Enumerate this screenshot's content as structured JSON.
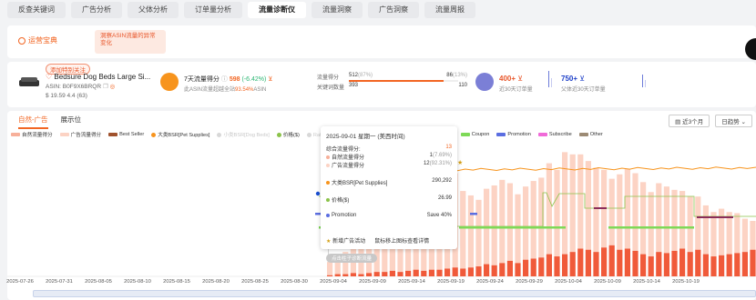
{
  "top_tabs": [
    "反查关键词",
    "广告分析",
    "父体分析",
    "订单量分析",
    "流量诊断仪",
    "流量洞察",
    "广告洞察",
    "流量周报"
  ],
  "top_tabs_active": 4,
  "subnav": {
    "item1": "运营宝典",
    "item2": "洞察ASIN流量的异常变化"
  },
  "product": {
    "tag": "添加特别关注",
    "title": "Bedsure Dog Beds Large Si...",
    "asin": "ASIN: B0F9X6BRQR",
    "price": "$ 19.59",
    "rating": "4.4 (63)"
  },
  "flow_score": {
    "label": "7天流量得分",
    "value": "598",
    "change": "(-6.42%)",
    "sub_prefix": "此ASIN流量超越全站",
    "sub_pct": "93.54%",
    "sub_suffix": "ASIN"
  },
  "keywords": {
    "row1_label": "流量得分",
    "row1_value": "512",
    "row1_pct": "(87%)",
    "row1_right": "86",
    "row1_right_pct": "(13%)",
    "row2_label": "关键词数量",
    "row2_value": "393",
    "row2_right": "110"
  },
  "orders": {
    "value": "400+",
    "label": "近30天订单量"
  },
  "parent_orders": {
    "value": "750+",
    "label": "父体近30天订单量"
  },
  "chart_tabs": [
    "自然-广告",
    "展示位"
  ],
  "chart_controls": [
    "近3个月",
    "日趋势"
  ],
  "legend": [
    {
      "label": "自然流量得分",
      "color": "#f7b09a",
      "kind": "sw",
      "faded": false
    },
    {
      "label": "广告流量得分",
      "color": "#fcd3c4",
      "kind": "sw",
      "faded": false
    },
    {
      "label": "Best Seller",
      "color": "#a0522d",
      "kind": "sw",
      "faded": false
    },
    {
      "label": "大类BSR[Pet Supplies]",
      "color": "#f7941d",
      "kind": "dt",
      "faded": false
    },
    {
      "label": "小类BSR[Dog Beds]",
      "color": "#d8d8d8",
      "kind": "dt",
      "faded": true
    },
    {
      "label": "价格($)",
      "color": "#8bc34a",
      "kind": "dt",
      "faded": false
    },
    {
      "label": "Ratings数量",
      "color": "#d8d8d8",
      "kind": "dt",
      "faded": true
    },
    {
      "label": "修改标题",
      "color": "#1a4fd0",
      "kind": "dt",
      "faded": false
    },
    {
      "label": "修改主图",
      "color": "#f5a623",
      "kind": "dt",
      "faded": false
    },
    {
      "label": "新增广告活动",
      "color": "#d4a017",
      "kind": "star",
      "faded": false
    },
    {
      "label": "Coupon",
      "color": "#7ed957",
      "kind": "sw",
      "faded": false
    },
    {
      "label": "Promotion",
      "color": "#5b6ee1",
      "kind": "sw",
      "faded": false
    },
    {
      "label": "Subscribe",
      "color": "#f06ad8",
      "kind": "sw",
      "faded": false
    },
    {
      "label": "Other",
      "color": "#9c8a74",
      "kind": "sw",
      "faded": false
    }
  ],
  "tooltip": {
    "title": "2025-09-01 星期一 (美西时间)",
    "score_label": "综合流量得分:",
    "score_value": "13",
    "natural_label": "自然流量得分",
    "natural_value": "1",
    "natural_pct": "(7.69%)",
    "ad_label": "广告流量得分",
    "ad_value": "12",
    "ad_pct": "(92.31%)",
    "bsr_label": "大类BSR[Pet Supplies]",
    "bsr_value": "290,292",
    "price_label": "价格($)",
    "price_value": "26.99",
    "promo_label": "Promotion",
    "promo_value": "Save 40%",
    "ad_new_label": "新增广告活动",
    "ad_new_hint": "鼠标移上图标查看详情"
  },
  "diag_button": "点击柱子诊断流量",
  "chart_data": {
    "type": "bar",
    "x_ticks": [
      "2025-07-26",
      "2025-07-31",
      "2025-08-05",
      "2025-08-10",
      "2025-08-15",
      "2025-08-20",
      "2025-08-25",
      "2025-08-30",
      "2025-09-04",
      "2025-09-09",
      "2025-09-14",
      "2025-09-19",
      "2025-09-24",
      "2025-09-29",
      "2025-10-04",
      "2025-10-09",
      "2025-10-14",
      "2025-10-19"
    ],
    "start_day": "2025-09-01",
    "series": [
      {
        "name": "自然流量得分",
        "values": [
          1,
          2,
          2,
          3,
          2,
          3,
          4,
          4,
          5,
          4,
          5,
          6,
          5,
          6,
          6,
          7,
          8,
          7,
          8,
          9,
          11,
          10,
          12,
          14,
          12,
          15,
          16,
          17,
          20,
          18,
          20,
          22,
          25,
          24,
          22,
          26,
          28,
          24,
          25,
          23,
          20,
          18,
          22,
          21,
          23,
          25,
          22,
          24,
          20,
          18,
          19,
          20,
          21,
          22,
          24,
          26,
          25,
          27,
          30
        ]
      },
      {
        "name": "广告流量得分",
        "values": [
          12,
          14,
          20,
          38,
          30,
          40,
          48,
          45,
          55,
          60,
          58,
          62,
          70,
          68,
          72,
          80,
          85,
          70,
          65,
          60,
          68,
          72,
          75,
          70,
          62,
          66,
          70,
          72,
          82,
          78,
          92,
          88,
          85,
          80,
          76,
          70,
          60,
          68,
          72,
          70,
          65,
          58,
          62,
          60,
          55,
          52,
          50,
          48,
          44,
          40,
          42,
          38,
          36,
          30,
          26,
          24,
          22,
          20,
          18
        ]
      }
    ],
    "ylim": [
      0,
      100
    ]
  }
}
